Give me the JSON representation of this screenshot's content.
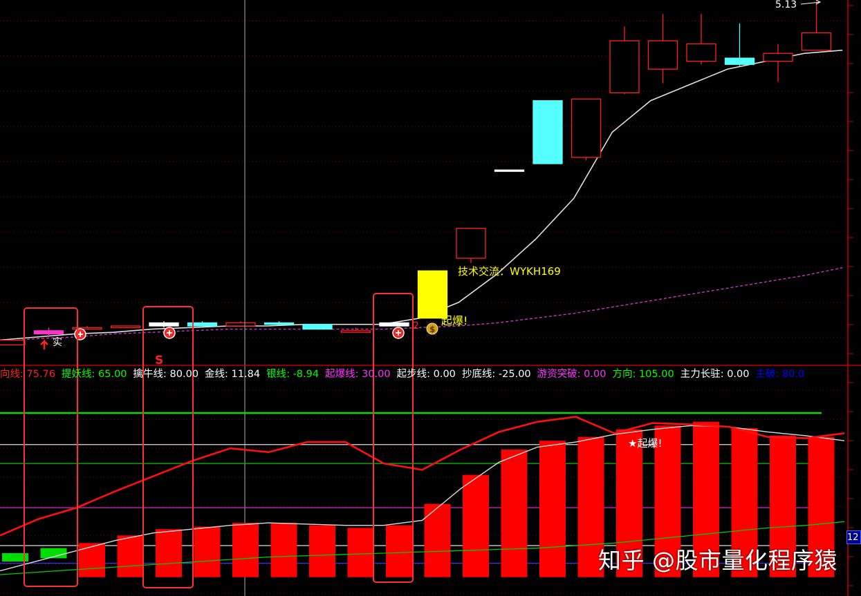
{
  "colors": {
    "background": "#000000",
    "up_candle": "#ff2020",
    "down_candle": "#55ffff",
    "gridline": "#8b0000",
    "yellow_candle": "#ffff00",
    "magenta_candle": "#ff33cc",
    "white_candle": "#ffffff"
  },
  "upper_panel": {
    "price_label": "5.13",
    "annotation_text": "技术交流：WYKH169",
    "breakout_label": "起爆!",
    "marker_labels": [
      "实",
      "S",
      "2"
    ],
    "dollar_icon": "$"
  },
  "indicator_bar": {
    "items": [
      {
        "name": "向线",
        "value": "75.76",
        "color": "#ff2020"
      },
      {
        "name": "提妖线",
        "value": "65.00",
        "color": "#00ff00"
      },
      {
        "name": "擒牛线",
        "value": "80.00",
        "color": "#ffffff"
      },
      {
        "name": "金线",
        "value": "11.84",
        "color": "#ffffff"
      },
      {
        "name": "银线",
        "value": "-8.94",
        "color": "#00ff00"
      },
      {
        "name": "起爆线",
        "value": "30.00",
        "color": "#ff33ff"
      },
      {
        "name": "起步线",
        "value": "0.00",
        "color": "#ffffff"
      },
      {
        "name": "抄底线",
        "value": "-25.00",
        "color": "#ffffff"
      },
      {
        "name": "游资突破",
        "value": "0.00",
        "color": "#ff33ff"
      },
      {
        "name": "方向",
        "value": "105.00",
        "color": "#00ff00"
      },
      {
        "name": "主力长驻",
        "value": "0.00",
        "color": "#ffffff"
      },
      {
        "name": "主破",
        "value": "80.0",
        "color": "#0000ff"
      }
    ]
  },
  "lower_panel": {
    "breakout_label": "★起爆!",
    "right_tag": "12"
  },
  "watermark": "知乎 @股市量化程序猿",
  "chart_data": [
    {
      "type": "candlestick",
      "title": "",
      "last_price_label": 5.13,
      "candles": [
        {
          "o": 2.95,
          "c": 2.98,
          "h": 2.98,
          "l": 2.95,
          "color": "red"
        },
        {
          "o": 3.02,
          "c": 3.04,
          "h": 3.06,
          "l": 3.0,
          "color": "magenta"
        },
        {
          "o": 3.05,
          "c": 3.06,
          "h": 3.07,
          "l": 3.05,
          "color": "red"
        },
        {
          "o": 3.07,
          "c": 3.06,
          "h": 3.07,
          "l": 3.06,
          "color": "red"
        },
        {
          "o": 3.07,
          "c": 3.09,
          "h": 3.1,
          "l": 3.06,
          "color": "white"
        },
        {
          "o": 3.09,
          "c": 3.07,
          "h": 3.1,
          "l": 3.07,
          "color": "cyan"
        },
        {
          "o": 3.07,
          "c": 3.09,
          "h": 3.1,
          "l": 3.07,
          "color": "red"
        },
        {
          "o": 3.09,
          "c": 3.08,
          "h": 3.1,
          "l": 3.08,
          "color": "cyan"
        },
        {
          "o": 3.08,
          "c": 3.05,
          "h": 3.08,
          "l": 3.05,
          "color": "cyan"
        },
        {
          "o": 3.03,
          "c": 3.04,
          "h": 3.06,
          "l": 3.03,
          "color": "red"
        },
        {
          "o": 3.07,
          "c": 3.09,
          "h": 3.09,
          "l": 3.07,
          "color": "white"
        },
        {
          "o": 3.12,
          "c": 3.42,
          "h": 3.42,
          "l": 3.12,
          "color": "yellow"
        },
        {
          "o": 3.5,
          "c": 3.69,
          "h": 3.69,
          "l": 3.47,
          "color": "red"
        },
        {
          "o": 4.06,
          "c": 4.06,
          "h": 4.06,
          "l": 4.06,
          "color": "white"
        },
        {
          "o": 4.5,
          "c": 4.1,
          "h": 4.5,
          "l": 4.1,
          "color": "cyan"
        },
        {
          "o": 4.14,
          "c": 4.51,
          "h": 4.51,
          "l": 4.12,
          "color": "red"
        },
        {
          "o": 4.55,
          "c": 4.88,
          "h": 4.97,
          "l": 4.54,
          "color": "red"
        },
        {
          "o": 4.7,
          "c": 4.88,
          "h": 5.05,
          "l": 4.61,
          "color": "red"
        },
        {
          "o": 4.75,
          "c": 4.86,
          "h": 5.05,
          "l": 4.73,
          "color": "red"
        },
        {
          "o": 4.77,
          "c": 4.73,
          "h": 4.99,
          "l": 4.72,
          "color": "cyan"
        },
        {
          "o": 4.75,
          "c": 4.8,
          "h": 4.86,
          "l": 4.62,
          "color": "red"
        },
        {
          "o": 4.82,
          "c": 4.93,
          "h": 5.13,
          "l": 4.82,
          "color": "red"
        }
      ],
      "ma_white": [
        2.98,
        3.0,
        3.02,
        3.03,
        3.05,
        3.06,
        3.07,
        3.07,
        3.08,
        3.08,
        3.08,
        3.12,
        3.22,
        3.4,
        3.62,
        3.88,
        4.3,
        4.5,
        4.6,
        4.7,
        4.75,
        4.8,
        4.82
      ],
      "ma_magenta_dashed": [
        2.97,
        2.99,
        3.0,
        3.02,
        3.03,
        3.04,
        3.05,
        3.05,
        3.05,
        3.05,
        3.05,
        3.06,
        3.07,
        3.09,
        3.12,
        3.15,
        3.19,
        3.23,
        3.27,
        3.31,
        3.35,
        3.39,
        3.44
      ]
    },
    {
      "type": "bar",
      "title": "",
      "ylim": [
        -25,
        110
      ],
      "reference_lines": {
        "green_line": 105,
        "white_line": 80,
        "green_line_2": 65,
        "magenta_line": 30,
        "white_line_2": 0
      },
      "bars": [
        -6,
        -2,
        2,
        8,
        13,
        15,
        18,
        18,
        16,
        14,
        16,
        33,
        56,
        76,
        83,
        86,
        92,
        95,
        98,
        93,
        87,
        86
      ],
      "bar_colors": [
        "green",
        "green",
        "red",
        "red",
        "red",
        "red",
        "red",
        "red",
        "red",
        "red",
        "red",
        "red",
        "red",
        "red",
        "red",
        "red",
        "red",
        "red",
        "red",
        "red",
        "red",
        "red"
      ],
      "red_line": [
        8,
        21,
        30,
        43,
        55,
        67,
        77,
        74,
        82,
        82,
        65,
        60,
        76,
        90,
        98,
        102,
        89,
        97,
        96,
        94,
        86,
        85,
        89
      ],
      "white_line": [
        -20,
        -12,
        -4,
        4,
        10,
        13,
        16,
        18,
        17,
        16,
        16,
        20,
        45,
        66,
        78,
        82,
        88,
        92,
        95,
        94,
        90,
        87,
        83
      ],
      "green_line": [
        -23,
        -21,
        -19,
        -17,
        -15,
        -13,
        -11,
        -9,
        -8,
        -7,
        -6,
        -5,
        -4,
        -3,
        -2,
        0,
        2,
        5,
        8,
        11,
        14,
        16,
        19
      ]
    }
  ]
}
